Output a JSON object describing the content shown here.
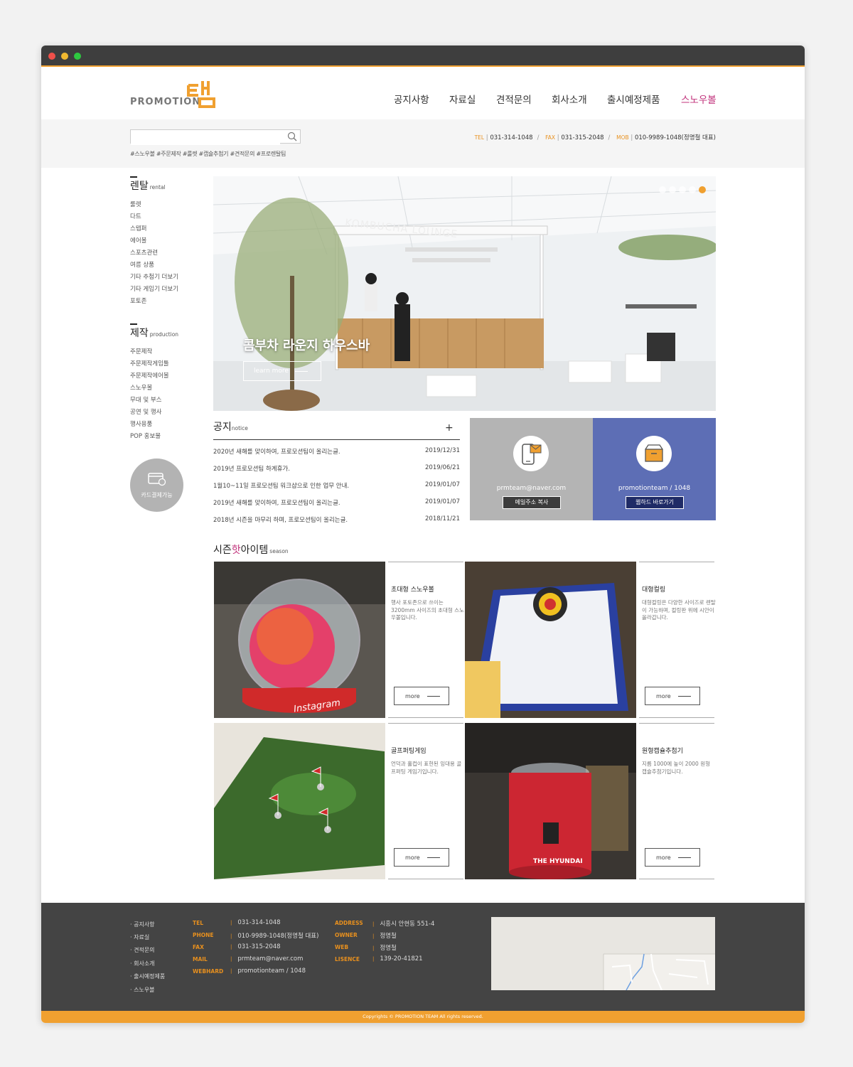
{
  "brand": {
    "name": "PROMOTION",
    "accent": "#f0a030",
    "active_nav": "#c0307a"
  },
  "nav": [
    "공지사항",
    "자료실",
    "견적문의",
    "회사소개",
    "출시예정제품",
    "스노우볼"
  ],
  "search": {
    "placeholder": ""
  },
  "tags": "#스노우볼 #주문제작 #룰렛 #캡슐추첨기 #견적문의 #프로렌탈팀",
  "contact": {
    "tel_label": "TEL",
    "tel": "031-314-1048",
    "fax_label": "FAX",
    "fax": "031-315-2048",
    "mob_label": "MOB",
    "mob": "010-9989-1048(정명철 대표)"
  },
  "sidebar": {
    "rental": {
      "title": "렌탈",
      "en": "rental",
      "items": [
        "룰렛",
        "다트",
        "스텝퍼",
        "에어볼",
        "스포츠관련",
        "여름 상품",
        "기타 추첨기 더보기",
        "기타 게임기 더보기",
        "포토존"
      ]
    },
    "production": {
      "title": "제작",
      "en": "production",
      "items": [
        "주문제작",
        "주문제작게임툴",
        "주문제작에어볼",
        "스노우볼",
        "무대 및 부스",
        "공연 및 행사",
        "행사용품",
        "POP 홍보물"
      ]
    },
    "card_badge": "카드결제가능"
  },
  "hero": {
    "caption": "콤부차 라운지 하우스바",
    "button": "learn more",
    "sign": "KOMBUCHA LOUNGE"
  },
  "notice": {
    "title": "공지",
    "en": "notice",
    "more": "+",
    "rows": [
      {
        "title": "2020년 새해를 맞이하여, 프로모션팀이 올리는글.",
        "date": "2019/12/31"
      },
      {
        "title": "2019년 프로모션팀 하계휴가.",
        "date": "2019/06/21"
      },
      {
        "title": "1월10~11일 프로모션팀 워크샵으로 인한 업무 안내.",
        "date": "2019/01/07"
      },
      {
        "title": "2019년 새해를 맞이하여, 프로모션팀이 올리는글.",
        "date": "2019/01/07"
      },
      {
        "title": "2018년 시즌을 마무리 하며, 프로모션팀이 올리는글.",
        "date": "2018/11/21"
      }
    ]
  },
  "mail_box": {
    "text": "prmteam@naver.com",
    "button": "메일주소 복사"
  },
  "webhard_box": {
    "text": "promotionteam / 1048",
    "button": "웹하드 바로가기"
  },
  "season": {
    "title_a": "시즌",
    "title_b": "핫",
    "title_c": "아이템",
    "en": "season",
    "items": [
      {
        "title": "초대형 스노우볼",
        "desc": "행사 포토존으로 쓰이는 3200mm 사이즈의 초대형 스노우볼입니다.",
        "more": "more",
        "photo_text": "Instagram"
      },
      {
        "title": "대형컬링",
        "desc": "대형컬링은 다양한 사이즈로 렌탈이 가능하며, 컬링판 위에 시안이 올라갑니다.",
        "more": "more",
        "photo_text": ""
      },
      {
        "title": "골프퍼팅게임",
        "desc": "언덕과 홀컵이 표현된 잉대용 골프퍼팅 게임기입니다.",
        "more": "more",
        "photo_text": ""
      },
      {
        "title": "원형캡슐추첨기",
        "desc": "지름 1000에 높이 2000 원형 캡슐추첨기입니다.",
        "more": "more",
        "photo_text": "THE HYUNDAI"
      }
    ]
  },
  "footer": {
    "nav": [
      "공지사항",
      "자료실",
      "견적문의",
      "회사소개",
      "출시예정제품",
      "스노우볼"
    ],
    "col1": [
      {
        "label": "TEL",
        "value": "031-314-1048"
      },
      {
        "label": "PHONE",
        "value": "010-9989-1048(정명철 대표)"
      },
      {
        "label": "FAX",
        "value": "031-315-2048"
      },
      {
        "label": "MAIL",
        "value": "prmteam@naver.com"
      },
      {
        "label": "WEBHARD",
        "value": "promotionteam / 1048"
      }
    ],
    "col2": [
      {
        "label": "ADDRESS",
        "value": "시흥시 안현동 551-4"
      },
      {
        "label": "OWNER",
        "value": "정명철"
      },
      {
        "label": "WEB",
        "value": "정명철"
      },
      {
        "label": "LISENCE",
        "value": "139-20-41821"
      }
    ],
    "copyright": "Copyrights © PROMOTION TEAM All rights reserved."
  }
}
